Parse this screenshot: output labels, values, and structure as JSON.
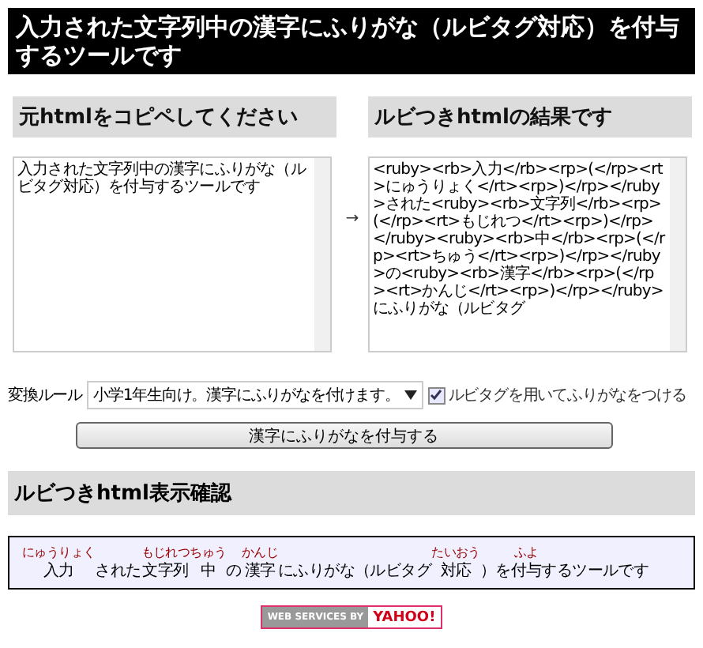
{
  "title": "入力された文字列中の漢字にふりがな（ルビタグ対応）を付与するツールです",
  "input_panel": {
    "heading": "元htmlをコピペしてください",
    "value": "入力された文字列中の漢字にふりがな（ルビタグ対応）を付与するツールです"
  },
  "arrow": "→",
  "output_panel": {
    "heading": "ルビつきhtmlの結果です",
    "value": "<ruby><rb>入力</rb><rp>(</rp><rt>にゅうりょく</rt><rp>)</rp></ruby>された<ruby><rb>文字列</rb><rp>(</rp><rt>もじれつ</rt><rp>)</rp></ruby><ruby><rb>中</rb><rp>(</rp><rt>ちゅう</rt><rp>)</rp></ruby>の<ruby><rb>漢字</rb><rp>(</rp><rt>かんじ</rt><rp>)</rp></ruby>にふりがな（ルビタグ"
  },
  "options": {
    "rule_label": "変換ルール",
    "rule_value": "小学1年生向け。漢字にふりがなを付けます。",
    "ruby_checkbox": {
      "label": "ルビタグを用いてふりがなをつける",
      "checked": true
    },
    "submit": "漢字にふりがなを付与する"
  },
  "preview": {
    "heading": "ルビつきhtml表示確認",
    "segments": [
      {
        "base": "入力",
        "ruby": "にゅうりょく"
      },
      {
        "base": "された"
      },
      {
        "base": "文字列",
        "ruby": "もじれつ"
      },
      {
        "base": "中",
        "ruby": "ちゅう"
      },
      {
        "base": "の"
      },
      {
        "base": "漢字",
        "ruby": "かんじ"
      },
      {
        "base": "にふりがな（ルビタグ"
      },
      {
        "base": "対応",
        "ruby": "たいおう"
      },
      {
        "base": "）を"
      },
      {
        "base": "付与",
        "ruby": "ふよ"
      },
      {
        "base": "するツールです"
      }
    ]
  },
  "footer": {
    "badge_left": "WEB SERVICES BY",
    "badge_right": "YAHOO!"
  }
}
